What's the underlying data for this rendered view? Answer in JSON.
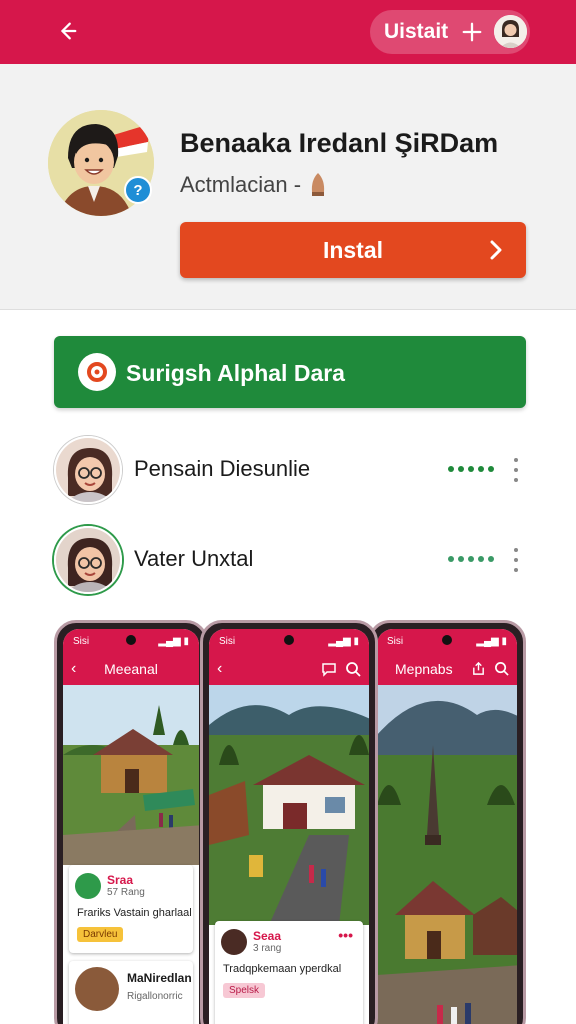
{
  "topbar": {
    "back_icon": "arrow-left-icon",
    "user_label": "Uistait",
    "plus_icon": "plus-icon",
    "accent": "#d6174b"
  },
  "app": {
    "title": "Benaaka Iredanl ŞiRDam",
    "subtitle": "Actmlacian -",
    "help_badge": "?",
    "install_label": "Instal",
    "install_color": "#e3481f"
  },
  "banner": {
    "label": "Surigsh Alphal Dara",
    "color": "#1f8a3b"
  },
  "contacts": [
    {
      "name": "Pensain Diesunlie",
      "status_dots": 5
    },
    {
      "name": "Vater Unxtal",
      "status_dots": 5
    }
  ],
  "phones": [
    {
      "time": "Sisi",
      "title": "Meeanal",
      "cards": [
        {
          "name": "Sraa",
          "meta": "57 Rang",
          "text": "Frariks Vastain gharlaal",
          "tag": "Darvleu"
        },
        {
          "name": "MaNiredlan",
          "meta": "Rigallonorric",
          "text": "",
          "tag": ""
        }
      ]
    },
    {
      "time": "Sisi",
      "title": "",
      "cards": [
        {
          "name": "Seaa",
          "meta": "3 rang",
          "text": "Tradqpkemaan yperdkal",
          "tag": "Spelsk"
        }
      ]
    },
    {
      "time": "Sisi",
      "title": "Mepnabs",
      "cards": []
    }
  ]
}
